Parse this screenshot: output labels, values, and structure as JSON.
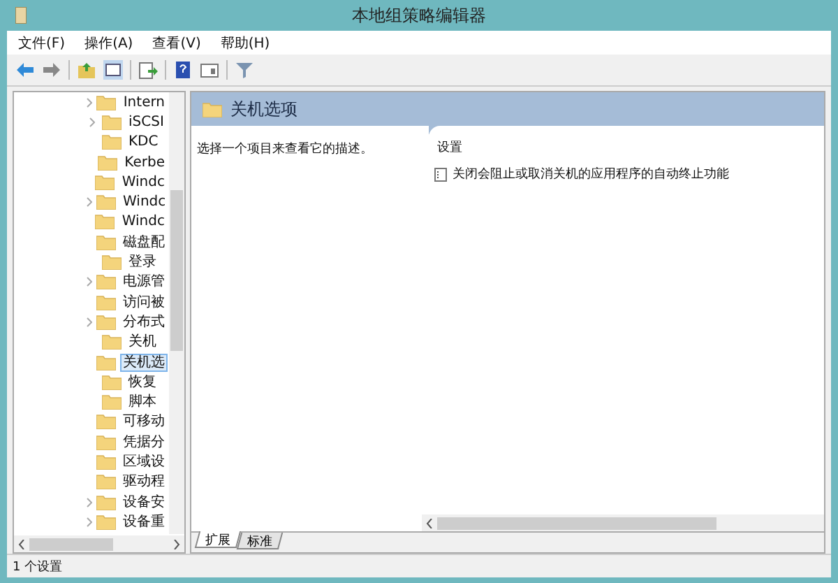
{
  "window": {
    "title": "本地组策略编辑器"
  },
  "menu": [
    "文件(F)",
    "操作(A)",
    "查看(V)",
    "帮助(H)"
  ],
  "tree": [
    {
      "label": "Intern",
      "expandable": true,
      "selected": false
    },
    {
      "label": "iSCSI",
      "expandable": true,
      "selected": false
    },
    {
      "label": "KDC",
      "expandable": false,
      "selected": false
    },
    {
      "label": "Kerbe",
      "expandable": false,
      "selected": false
    },
    {
      "label": "Windc",
      "expandable": false,
      "selected": false
    },
    {
      "label": "Windc",
      "expandable": true,
      "selected": false
    },
    {
      "label": "Windc",
      "expandable": false,
      "selected": false
    },
    {
      "label": "磁盘配",
      "expandable": false,
      "selected": false
    },
    {
      "label": "登录",
      "expandable": false,
      "selected": false
    },
    {
      "label": "电源管",
      "expandable": true,
      "selected": false
    },
    {
      "label": "访问被",
      "expandable": false,
      "selected": false
    },
    {
      "label": "分布式",
      "expandable": true,
      "selected": false
    },
    {
      "label": "关机",
      "expandable": false,
      "selected": false
    },
    {
      "label": "关机选",
      "expandable": false,
      "selected": true
    },
    {
      "label": "恢复",
      "expandable": false,
      "selected": false
    },
    {
      "label": "脚本",
      "expandable": false,
      "selected": false
    },
    {
      "label": "可移动",
      "expandable": false,
      "selected": false
    },
    {
      "label": "凭据分",
      "expandable": false,
      "selected": false
    },
    {
      "label": "区域设",
      "expandable": false,
      "selected": false
    },
    {
      "label": "驱动程",
      "expandable": false,
      "selected": false
    },
    {
      "label": "设备安",
      "expandable": true,
      "selected": false
    },
    {
      "label": "设备重",
      "expandable": true,
      "selected": false
    }
  ],
  "header": {
    "title": "关机选项"
  },
  "description": "选择一个项目来查看它的描述。",
  "settings": {
    "column": "设置",
    "rows": [
      "关闭会阻止或取消关机的应用程序的自动终止功能"
    ]
  },
  "tabs": [
    {
      "label": "扩展",
      "selected": true
    },
    {
      "label": "标准",
      "selected": false
    }
  ],
  "status_bar": "1 个设置"
}
